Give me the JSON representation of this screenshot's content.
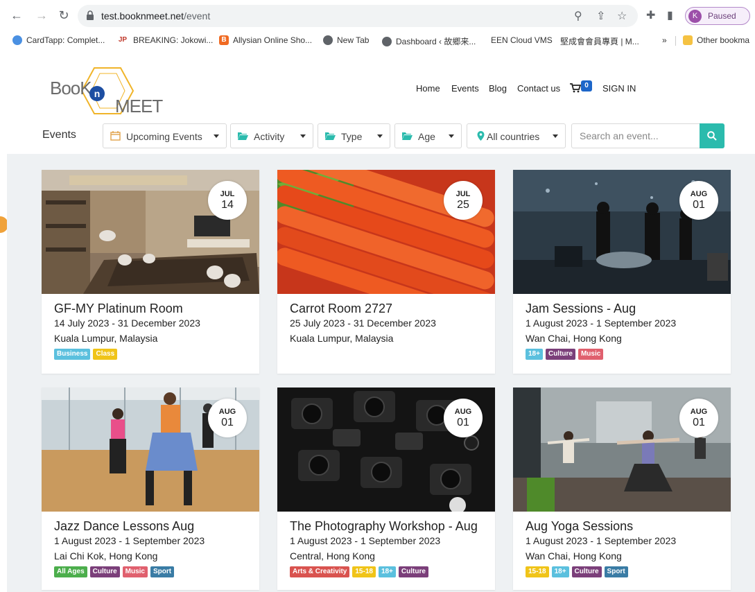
{
  "browser": {
    "url_host": "test.booknmeet.net",
    "url_path": "/event",
    "profile_initial": "K",
    "profile_status": "Paused",
    "bookmarks": [
      {
        "label": "CardTapp: Complet...",
        "color": "#4a90e2"
      },
      {
        "label": "BREAKING: Jokowi...",
        "color": "#c0392b"
      },
      {
        "label": "Allysian Online Sho...",
        "color": "#f06a22"
      },
      {
        "label": "New Tab",
        "color": "#5f6368"
      },
      {
        "label": "Dashboard ‹ 故郷来...",
        "color": "#5f6368"
      },
      {
        "label": "EEN Cloud VMS",
        "color": ""
      },
      {
        "label": "堅成會會員專頁 | M...",
        "color": ""
      }
    ],
    "bookmarks_overflow": "»",
    "other_bookmarks": "Other bookma"
  },
  "site": {
    "logo_word1": "BooK",
    "logo_n": "n",
    "logo_word2": "MEET",
    "nav": [
      "Home",
      "Events",
      "Blog",
      "Contact us"
    ],
    "cart_count": "0",
    "sign_in": "SIGN IN"
  },
  "filters": {
    "section_label": "Events",
    "items": [
      "Upcoming Events",
      "Activity",
      "Type",
      "Age",
      "All countries"
    ],
    "search_placeholder": "Search an event..."
  },
  "tag_colors": {
    "Business": "#5bc0de",
    "Class": "#f0c419",
    "18+": "#5bc0de",
    "Culture": "#7b3f7a",
    "Music": "#e0606e",
    "All Ages": "#4cae4c",
    "Sport": "#3a7ca5",
    "Arts & Creativity": "#d9534f",
    "15-18": "#f0c419"
  },
  "events": [
    {
      "title": "GF-MY Platinum Room",
      "date_range": "14 July 2023 - 31 December 2023",
      "location": "Kuala Lumpur, Malaysia",
      "month": "JUL",
      "day": "14",
      "tags": [
        "Business",
        "Class"
      ],
      "image": "meeting-room"
    },
    {
      "title": "Carrot Room 2727",
      "date_range": "25 July 2023 - 31 December 2023",
      "location": "Kuala Lumpur, Malaysia",
      "month": "JUL",
      "day": "25",
      "tags": [],
      "image": "carrots"
    },
    {
      "title": "Jam Sessions - Aug",
      "date_range": "1 August 2023 - 1 September 2023",
      "location": "Wan Chai, Hong Kong",
      "month": "AUG",
      "day": "01",
      "tags": [
        "18+",
        "Culture",
        "Music"
      ],
      "image": "band"
    },
    {
      "title": "Jazz Dance Lessons Aug",
      "date_range": "1 August 2023 - 1 September 2023",
      "location": "Lai Chi Kok, Hong Kong",
      "month": "AUG",
      "day": "01",
      "tags": [
        "All Ages",
        "Culture",
        "Music",
        "Sport"
      ],
      "image": "dance"
    },
    {
      "title": "The Photography Workshop - Aug",
      "date_range": "1 August 2023 - 1 September 2023",
      "location": "Central, Hong Kong",
      "month": "AUG",
      "day": "01",
      "tags": [
        "Arts & Creativity",
        "15-18",
        "18+",
        "Culture"
      ],
      "image": "cameras"
    },
    {
      "title": "Aug Yoga Sessions",
      "date_range": "1 August 2023 - 1 September 2023",
      "location": "Wan Chai, Hong Kong",
      "month": "AUG",
      "day": "01",
      "tags": [
        "15-18",
        "18+",
        "Culture",
        "Sport"
      ],
      "image": "yoga"
    }
  ]
}
